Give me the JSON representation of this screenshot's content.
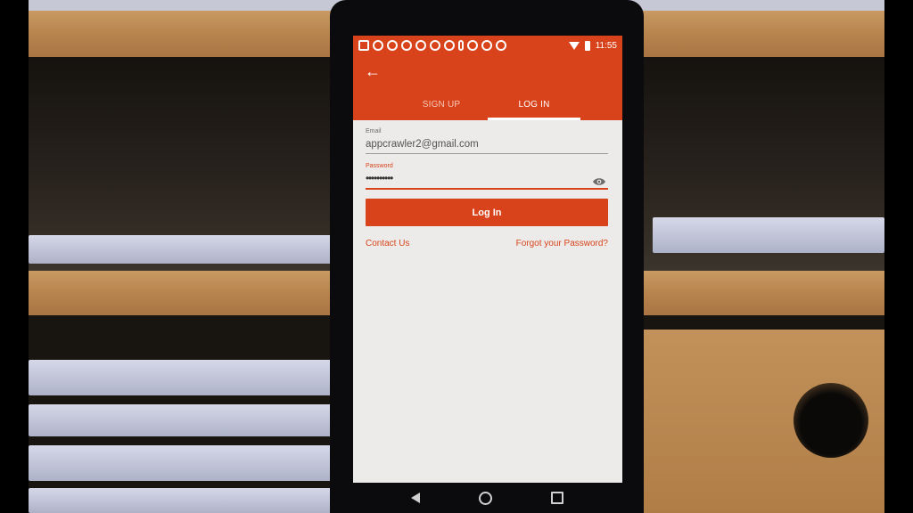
{
  "status_bar": {
    "time": "11:55",
    "icons": [
      "message-icon",
      "notification-icon",
      "notification-icon",
      "notification-icon",
      "notification-icon",
      "notification-icon",
      "notification-icon",
      "pin-icon",
      "notification-icon",
      "notification-icon",
      "copyright-icon",
      "wifi-icon",
      "battery-icon"
    ]
  },
  "toolbar": {
    "back_icon": "arrow-left-icon"
  },
  "tabs": [
    {
      "label": "SIGN UP",
      "active": false
    },
    {
      "label": "LOG IN",
      "active": true
    }
  ],
  "form": {
    "email": {
      "label": "Email",
      "value": "appcrawler2@gmail.com"
    },
    "password": {
      "label": "Password",
      "value": "••••••••••",
      "toggle_icon": "eye-icon"
    },
    "submit_label": "Log In"
  },
  "links": {
    "contact": "Contact Us",
    "forgot": "Forgot your Password?"
  },
  "colors": {
    "accent": "#d8431b",
    "background": "#ecebe9"
  },
  "nav_bar": [
    "back-triangle-icon",
    "home-circle-icon",
    "recents-square-icon"
  ]
}
